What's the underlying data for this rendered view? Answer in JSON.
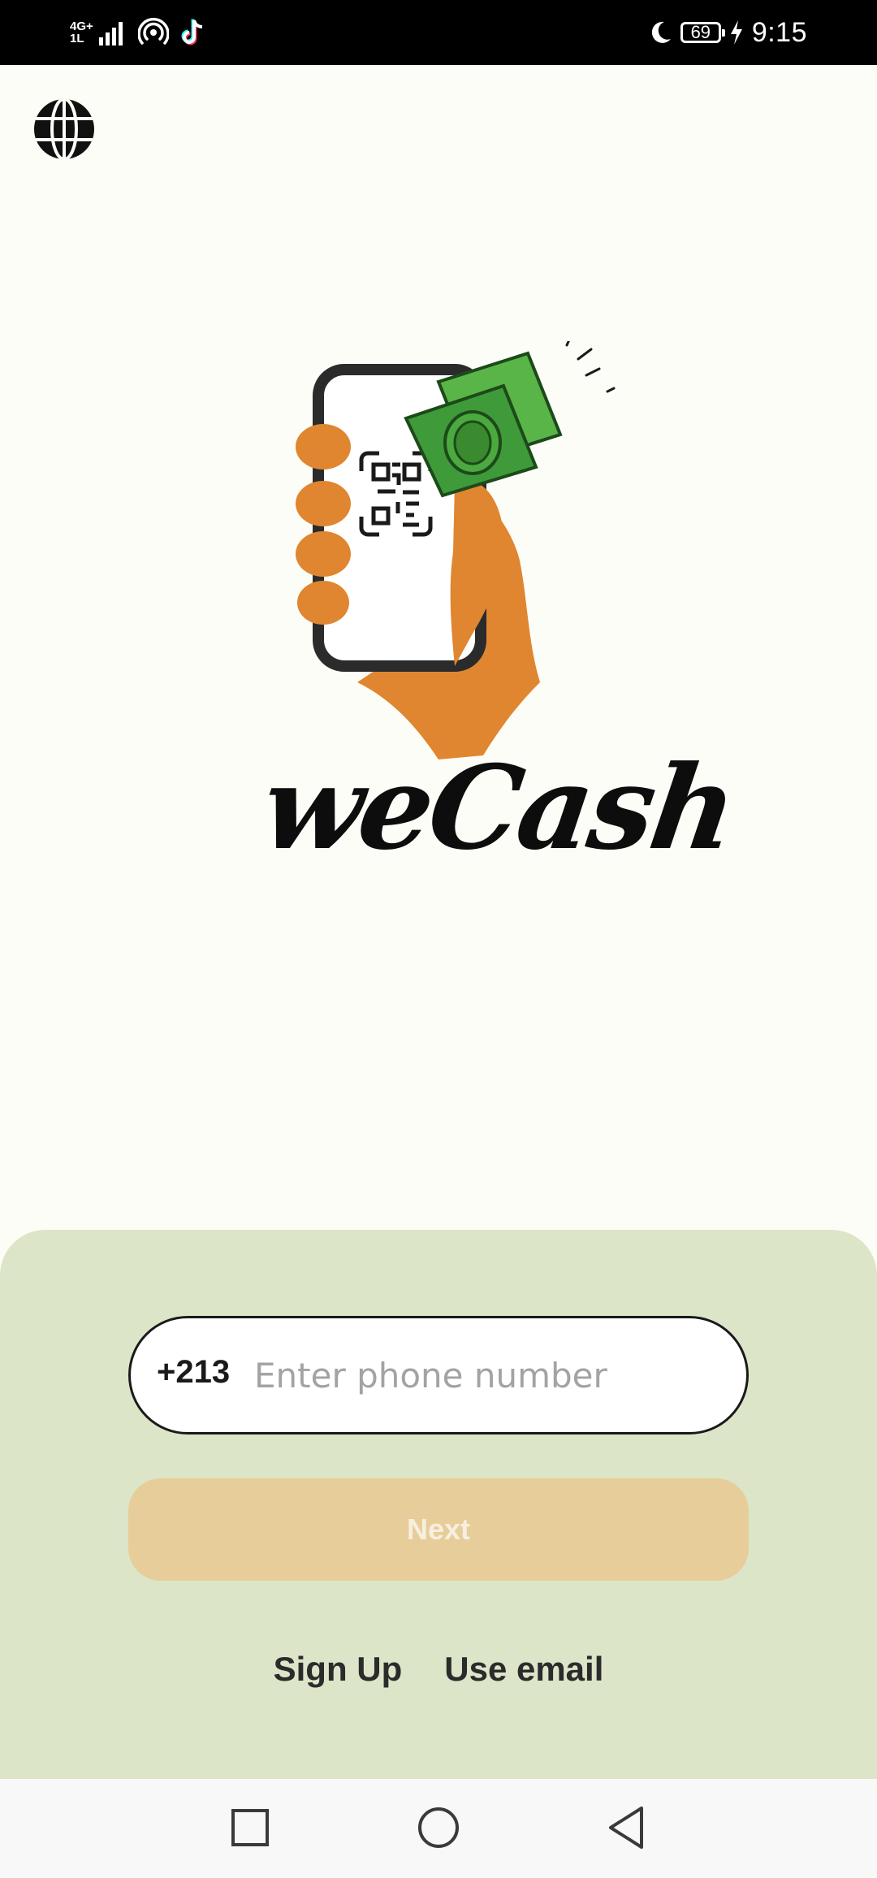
{
  "status_bar": {
    "network_label_top": "4G+",
    "network_label_bottom": "1L",
    "battery": "69",
    "time": "9:15",
    "icons": [
      "signal-icon",
      "hotspot-icon",
      "tiktok-icon",
      "moon-icon",
      "battery-icon",
      "charging-icon"
    ]
  },
  "header": {
    "language_icon": "globe-icon"
  },
  "brand": {
    "name": "weCash",
    "colors": {
      "hand": "#e08630",
      "cash": "#3f9a3a",
      "ink": "#1a1a1a"
    }
  },
  "login": {
    "country_code": "+213",
    "phone_placeholder": "Enter phone number",
    "phone_value": "",
    "next_label": "Next",
    "sign_up_label": "Sign Up",
    "use_email_label": "Use email"
  },
  "nav": {
    "icons": [
      "recent-apps-icon",
      "home-icon",
      "back-icon"
    ]
  },
  "colors": {
    "background": "#fdfdf7",
    "panel": "#dce5c8",
    "next_button": "#e7cd99",
    "next_text": "#f7efdf"
  }
}
